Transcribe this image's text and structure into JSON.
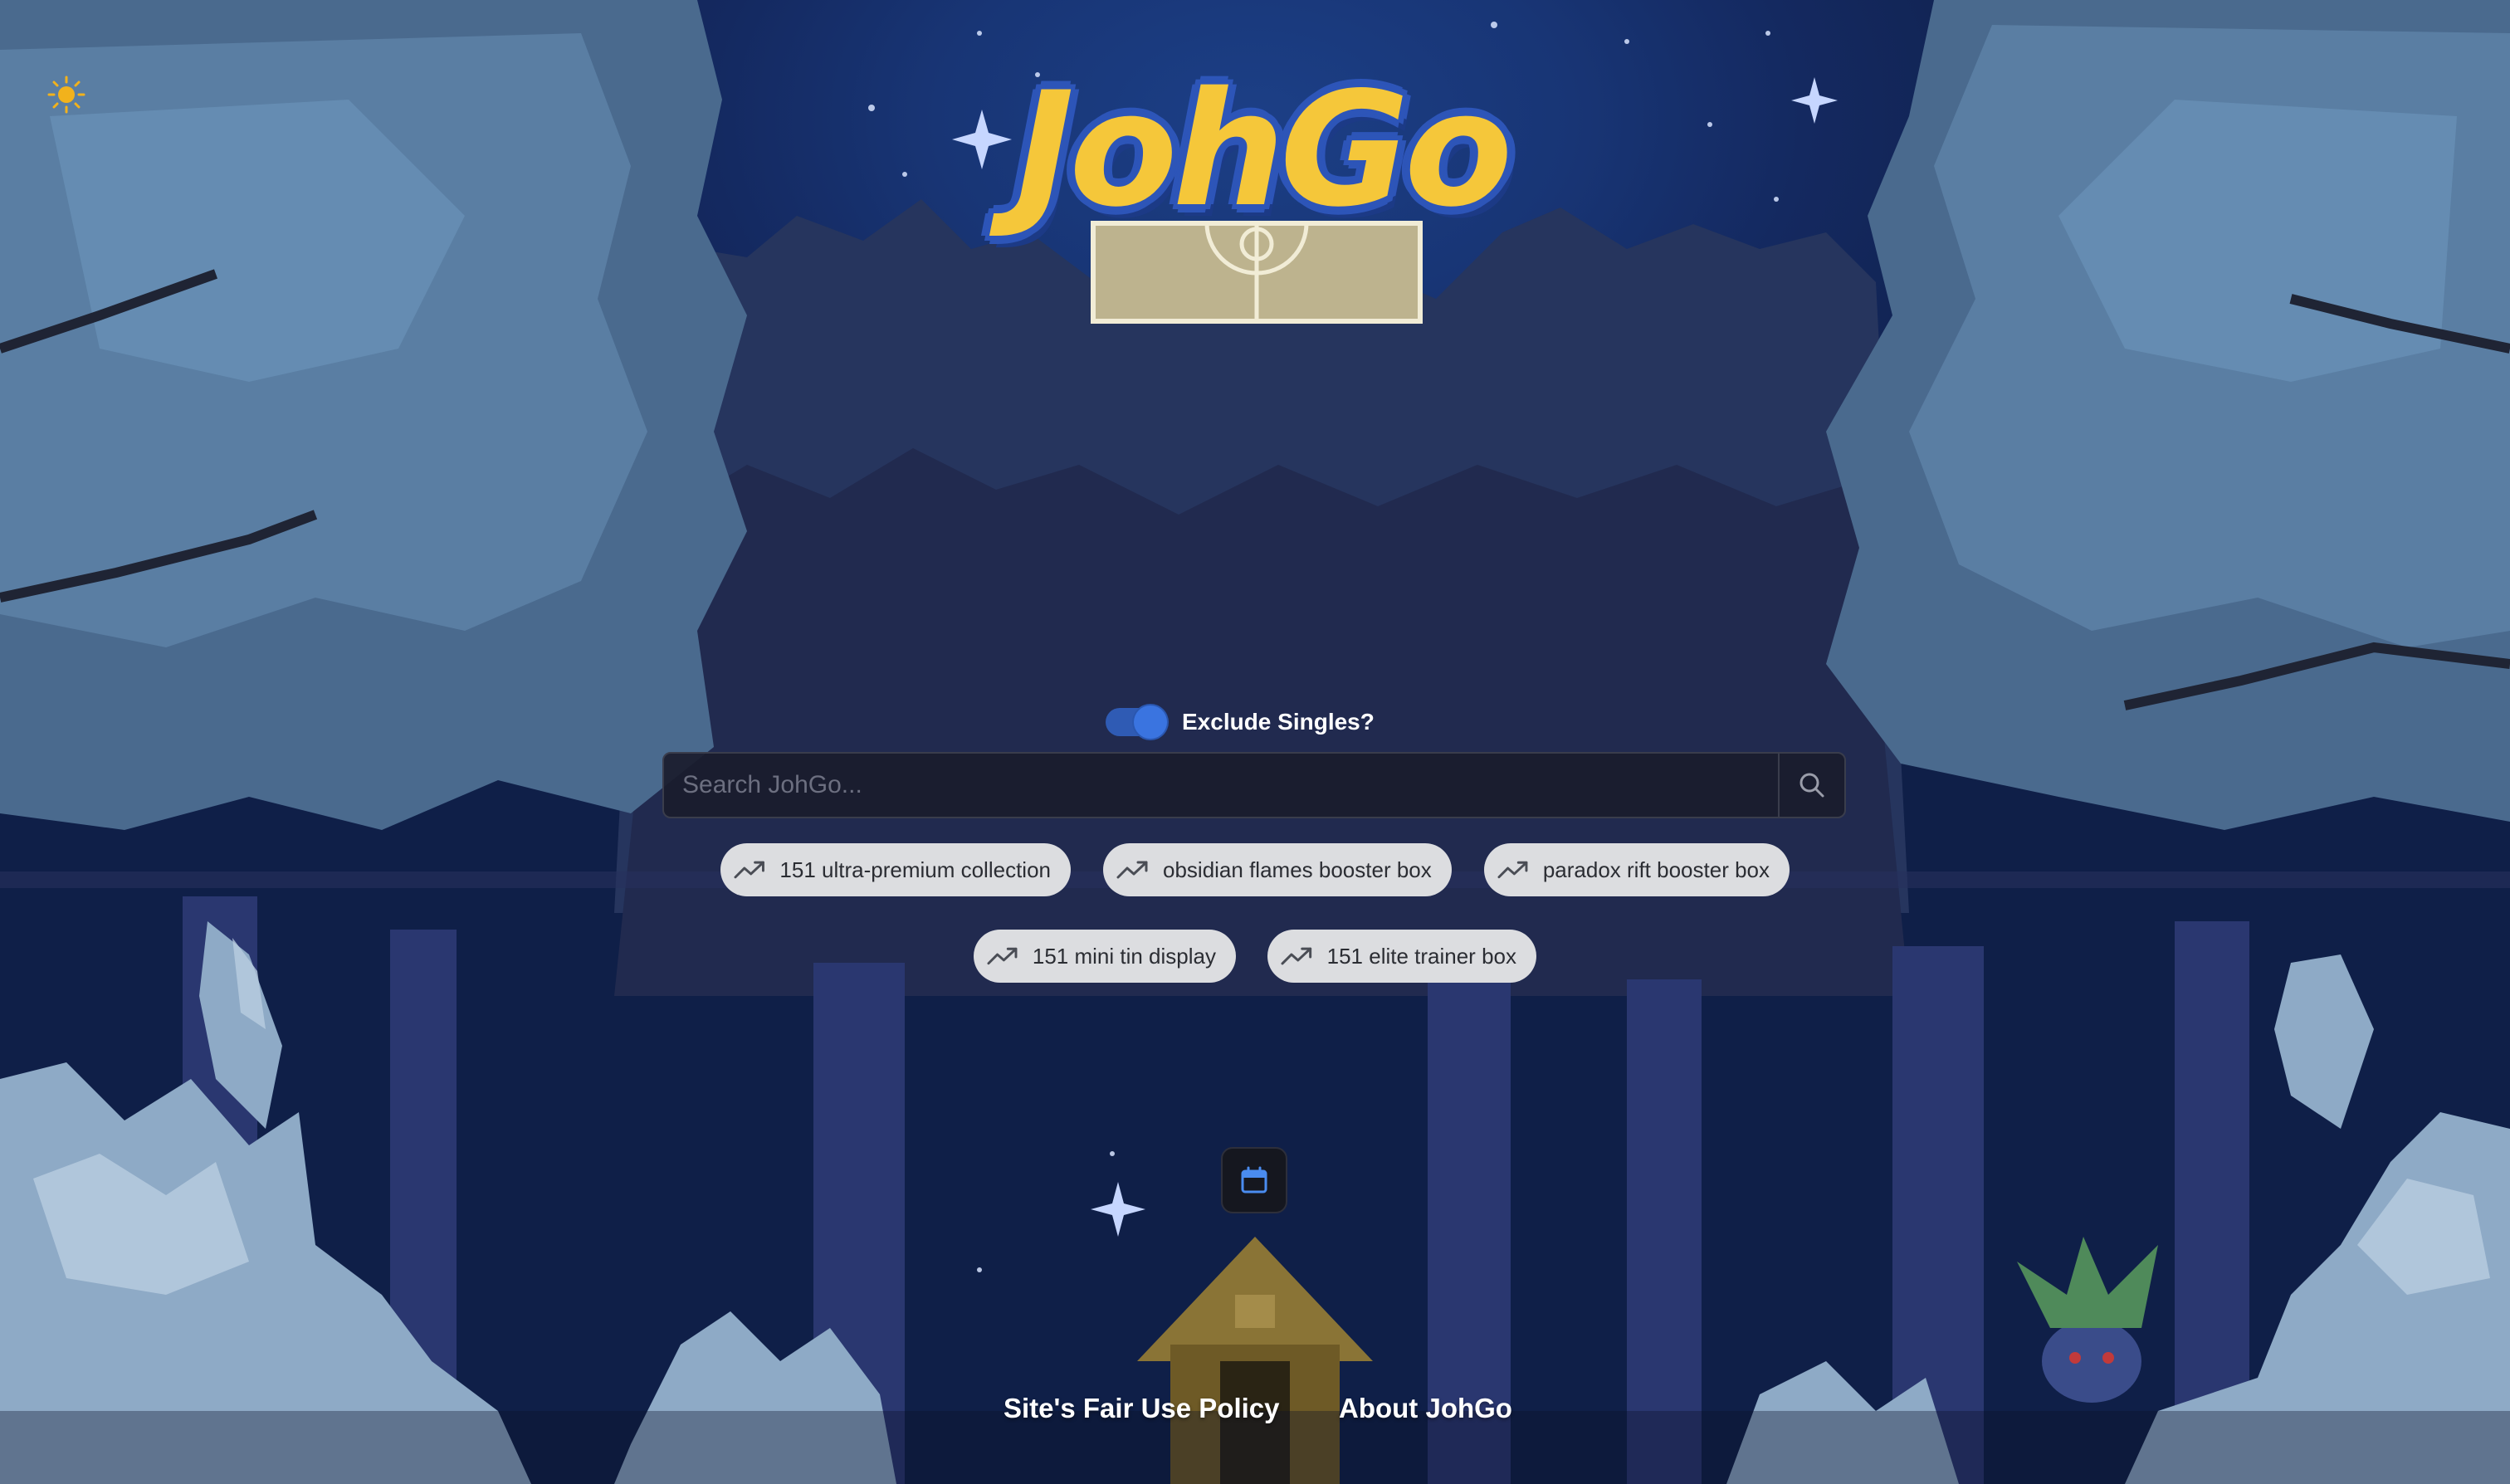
{
  "theme_toggle": {
    "icon": "sun-icon",
    "color": "#f2b21c"
  },
  "logo": {
    "text": "JohGo",
    "text_color": "#f5c73a",
    "outline_color": "#2d55b8"
  },
  "filter": {
    "label": "Exclude Singles?",
    "enabled": true
  },
  "search": {
    "placeholder": "Search JohGo...",
    "value": "",
    "button_icon": "search-icon"
  },
  "trending": [
    {
      "label": "151 ultra-premium collection",
      "icon": "trending-up-icon"
    },
    {
      "label": "obsidian flames booster box",
      "icon": "trending-up-icon"
    },
    {
      "label": "paradox rift booster box",
      "icon": "trending-up-icon"
    },
    {
      "label": "151 mini tin display",
      "icon": "trending-up-icon"
    },
    {
      "label": "151 elite trainer box",
      "icon": "trending-up-icon"
    }
  ],
  "calendar_button": {
    "icon": "calendar-icon",
    "accent": "#4a8cf0"
  },
  "footer": {
    "fair_use": "Site's Fair Use Policy",
    "about": "About JohGo"
  }
}
